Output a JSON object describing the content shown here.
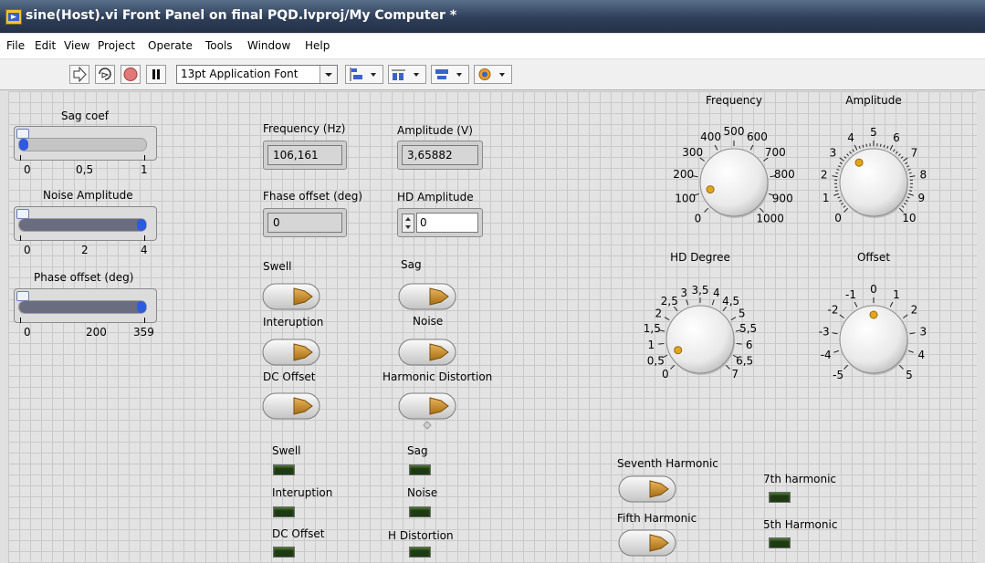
{
  "window": {
    "title": "sine(Host).vi Front Panel on final PQD.lvproj/My Computer *"
  },
  "menu": [
    "File",
    "Edit",
    "View",
    "Project",
    "Operate",
    "Tools",
    "Window",
    "Help"
  ],
  "toolbar": {
    "font": "13pt Application Font"
  },
  "sliders": [
    {
      "label": "Sag coef",
      "ticks": [
        "0",
        "0,5",
        "1"
      ],
      "value": 0
    },
    {
      "label": "Noise Amplitude",
      "ticks": [
        "0",
        "2",
        "4"
      ],
      "value": 4
    },
    {
      "label": "Phase offset (deg)",
      "ticks": [
        "0",
        "200",
        "359"
      ],
      "value": 359
    }
  ],
  "indicators": {
    "frequency": {
      "label": "Frequency (Hz)",
      "value": "106,161"
    },
    "amplitude": {
      "label": "Amplitude (V)",
      "value": "3,65882"
    },
    "phase": {
      "label": "Fhase offset (deg)",
      "value": "0"
    },
    "hd_amp": {
      "label": "HD Amplitude",
      "value": "0"
    }
  },
  "switches": {
    "swell": "Swell",
    "sag": "Sag",
    "interuption": "Interuption",
    "noise": "Noise",
    "dc_offset": "DC Offset",
    "harmonic_distortion": "Harmonic Distortion",
    "seventh": "Seventh Harmonic",
    "fifth": "Fifth Harmonic"
  },
  "leds": {
    "swell": "Swell",
    "sag": "Sag",
    "interuption": "Interuption",
    "noise": "Noise",
    "dc_offset": "DC Offset",
    "h_distortion": "H Distortion",
    "seventh": "7th harmonic",
    "fifth": "5th Harmonic"
  },
  "knobs": {
    "frequency": {
      "label": "Frequency",
      "ticks": [
        "0",
        "100",
        "200",
        "300",
        "400",
        "500",
        "600",
        "700",
        "800",
        "900",
        "1000"
      ],
      "value": 106.161
    },
    "amplitude": {
      "label": "Amplitude",
      "ticks": [
        "0",
        "1",
        "2",
        "3",
        "4",
        "5",
        "6",
        "7",
        "8",
        "9",
        "10"
      ],
      "value": 3.65882
    },
    "hd_degree": {
      "label": "HD Degree",
      "ticks": [
        "0",
        "0,5",
        "1",
        "1,5",
        "2",
        "2,5",
        "3",
        "3,5",
        "4",
        "4,5",
        "5",
        "5,5",
        "6",
        "6,5",
        "7"
      ],
      "value": 0.5
    },
    "offset": {
      "label": "Offset",
      "ticks": [
        "-5",
        "-4",
        "-3",
        "-2",
        "-1",
        "0",
        "1",
        "2",
        "3",
        "4",
        "5"
      ],
      "value": 0
    }
  }
}
